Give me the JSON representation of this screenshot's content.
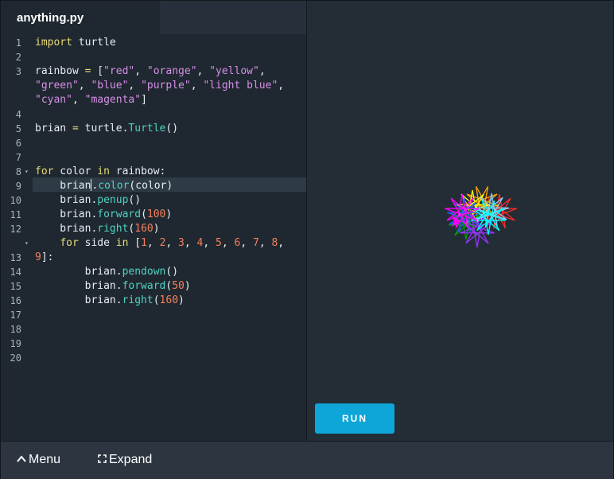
{
  "editor": {
    "tab_title": "anything.py",
    "line_numbers": [
      "1",
      "2",
      "3",
      "4",
      "5",
      "6",
      "7",
      "8",
      "9",
      "10",
      "11",
      "12",
      "13",
      "14",
      "15",
      "16",
      "17",
      "18",
      "19",
      "20"
    ],
    "code_lines": [
      [
        {
          "t": "import",
          "c": "kw"
        },
        {
          "t": " turtle",
          "c": "op"
        }
      ],
      [],
      [
        {
          "t": "rainbow ",
          "c": "op"
        },
        {
          "t": "=",
          "c": "kw"
        },
        {
          "t": " [",
          "c": "op"
        },
        {
          "t": "\"red\"",
          "c": "st"
        },
        {
          "t": ", ",
          "c": "op"
        },
        {
          "t": "\"orange\"",
          "c": "st"
        },
        {
          "t": ", ",
          "c": "op"
        },
        {
          "t": "\"yellow\"",
          "c": "st"
        },
        {
          "t": ",",
          "c": "op"
        }
      ],
      [
        {
          "t": "\"green\"",
          "c": "st"
        },
        {
          "t": ", ",
          "c": "op"
        },
        {
          "t": "\"blue\"",
          "c": "st"
        },
        {
          "t": ", ",
          "c": "op"
        },
        {
          "t": "\"purple\"",
          "c": "st"
        },
        {
          "t": ", ",
          "c": "op"
        },
        {
          "t": "\"light blue\"",
          "c": "st"
        },
        {
          "t": ",",
          "c": "op"
        }
      ],
      [
        {
          "t": "\"cyan\"",
          "c": "st"
        },
        {
          "t": ", ",
          "c": "op"
        },
        {
          "t": "\"magenta\"",
          "c": "st"
        },
        {
          "t": "]",
          "c": "op"
        }
      ],
      [],
      [
        {
          "t": "brian ",
          "c": "op"
        },
        {
          "t": "=",
          "c": "kw"
        },
        {
          "t": " turtle.",
          "c": "op"
        },
        {
          "t": "Turtle",
          "c": "fn"
        },
        {
          "t": "()",
          "c": "op"
        }
      ],
      [],
      [],
      [
        {
          "t": "for",
          "c": "kw"
        },
        {
          "t": " color ",
          "c": "op"
        },
        {
          "t": "in",
          "c": "kw"
        },
        {
          "t": " rainbow:",
          "c": "op"
        }
      ],
      [
        {
          "t": "    brian",
          "c": "op"
        },
        {
          "t": "|",
          "c": "cursor"
        },
        {
          "t": ".",
          "c": "op"
        },
        {
          "t": "color",
          "c": "fn"
        },
        {
          "t": "(color)",
          "c": "op"
        }
      ],
      [
        {
          "t": "    brian.",
          "c": "op"
        },
        {
          "t": "penup",
          "c": "fn"
        },
        {
          "t": "()",
          "c": "op"
        }
      ],
      [
        {
          "t": "    brian.",
          "c": "op"
        },
        {
          "t": "forward",
          "c": "fn"
        },
        {
          "t": "(",
          "c": "op"
        },
        {
          "t": "100",
          "c": "nm"
        },
        {
          "t": ")",
          "c": "op"
        }
      ],
      [
        {
          "t": "    brian.",
          "c": "op"
        },
        {
          "t": "right",
          "c": "fn"
        },
        {
          "t": "(",
          "c": "op"
        },
        {
          "t": "160",
          "c": "nm"
        },
        {
          "t": ")",
          "c": "op"
        }
      ],
      [
        {
          "t": "    ",
          "c": "op"
        },
        {
          "t": "for",
          "c": "kw"
        },
        {
          "t": " side ",
          "c": "op"
        },
        {
          "t": "in",
          "c": "kw"
        },
        {
          "t": " [",
          "c": "op"
        },
        {
          "t": "1",
          "c": "nm"
        },
        {
          "t": ", ",
          "c": "op"
        },
        {
          "t": "2",
          "c": "nm"
        },
        {
          "t": ", ",
          "c": "op"
        },
        {
          "t": "3",
          "c": "nm"
        },
        {
          "t": ", ",
          "c": "op"
        },
        {
          "t": "4",
          "c": "nm"
        },
        {
          "t": ", ",
          "c": "op"
        },
        {
          "t": "5",
          "c": "nm"
        },
        {
          "t": ", ",
          "c": "op"
        },
        {
          "t": "6",
          "c": "nm"
        },
        {
          "t": ", ",
          "c": "op"
        },
        {
          "t": "7",
          "c": "nm"
        },
        {
          "t": ", ",
          "c": "op"
        },
        {
          "t": "8",
          "c": "nm"
        },
        {
          "t": ",",
          "c": "op"
        }
      ],
      [
        {
          "t": "9",
          "c": "nm"
        },
        {
          "t": "]:",
          "c": "op"
        }
      ],
      [
        {
          "t": "        brian.",
          "c": "op"
        },
        {
          "t": "pendown",
          "c": "fn"
        },
        {
          "t": "()",
          "c": "op"
        }
      ],
      [
        {
          "t": "        brian.",
          "c": "op"
        },
        {
          "t": "forward",
          "c": "fn"
        },
        {
          "t": "(",
          "c": "op"
        },
        {
          "t": "50",
          "c": "nm"
        },
        {
          "t": ")",
          "c": "op"
        }
      ],
      [
        {
          "t": "        brian.",
          "c": "op"
        },
        {
          "t": "right",
          "c": "fn"
        },
        {
          "t": "(",
          "c": "op"
        },
        {
          "t": "160",
          "c": "nm"
        },
        {
          "t": ")",
          "c": "op"
        }
      ]
    ]
  },
  "output": {
    "run_label": "RUN",
    "star_colors": [
      "#ff2a2a",
      "#ffa500",
      "#ffff00",
      "#00a000",
      "#2255ff",
      "#9b30ff",
      "#87cefa",
      "#00ffff",
      "#ff00ff"
    ]
  },
  "bottombar": {
    "menu_label": "Menu",
    "expand_label": "Expand"
  },
  "colors": {
    "accent": "#0ea5d8",
    "editor_bg": "#1f2830",
    "output_bg": "#222d36"
  }
}
